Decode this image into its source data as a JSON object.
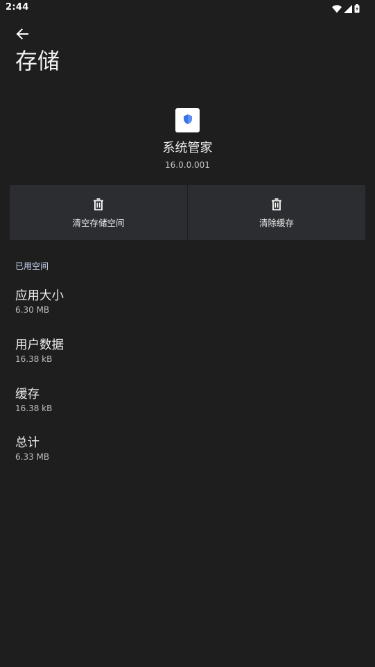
{
  "status_bar": {
    "time": "2:44",
    "icons": [
      "wifi-icon",
      "cellular-signal-icon",
      "battery-icon"
    ]
  },
  "header": {
    "back_icon": "arrow-left-icon",
    "title": "存储"
  },
  "app": {
    "icon": "shield-icon",
    "name": "系统管家",
    "version": "16.0.0.001"
  },
  "actions": [
    {
      "icon": "trash-icon",
      "label": "清空存储空间"
    },
    {
      "icon": "trash-icon",
      "label": "清除缓存"
    }
  ],
  "section": {
    "title": "已用空间"
  },
  "items": [
    {
      "title": "应用大小",
      "value": "6.30 MB"
    },
    {
      "title": "用户数据",
      "value": "16.38 kB"
    },
    {
      "title": "缓存",
      "value": "16.38 kB"
    },
    {
      "title": "总计",
      "value": "6.33 MB"
    }
  ],
  "colors": {
    "background": "#1e1e1f",
    "button_background": "#2c2d31",
    "section_accent": "#c8d4f0",
    "shield_blue": "#3b74e6"
  }
}
